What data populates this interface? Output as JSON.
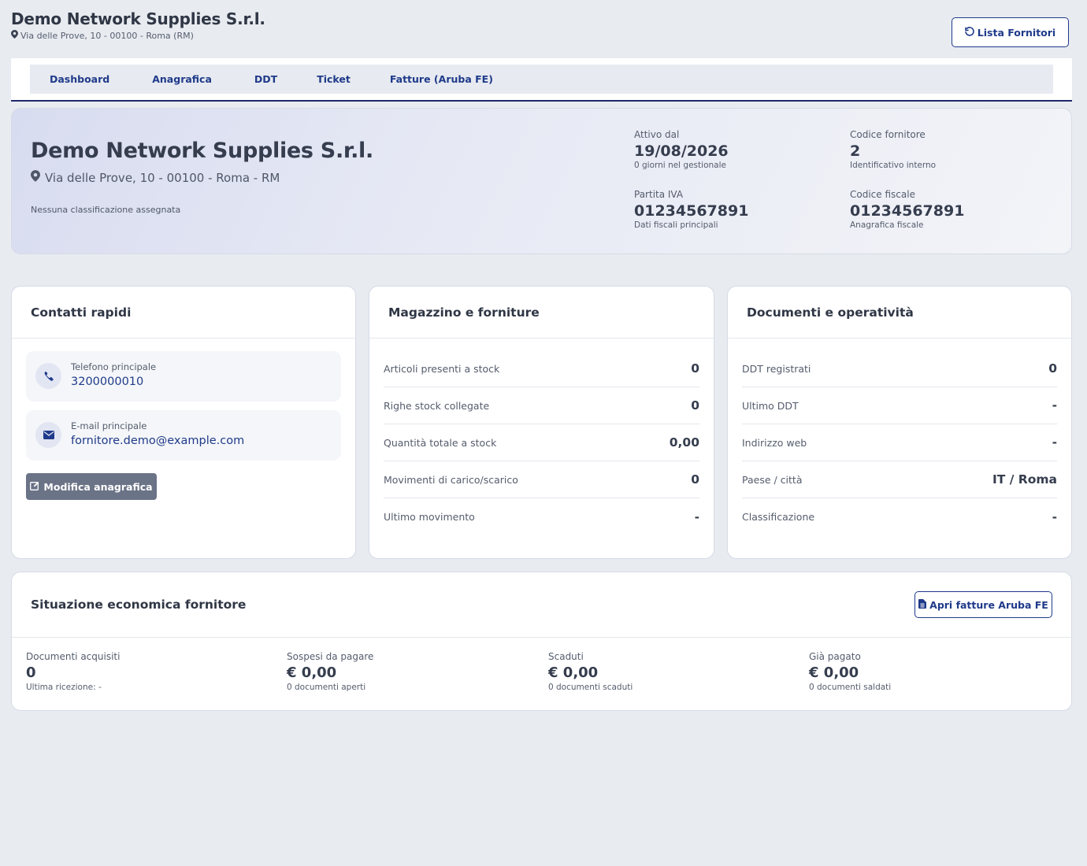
{
  "header": {
    "title": "Demo Network Supplies S.r.l.",
    "address": "Via delle Prove, 10 - 00100 - Roma (RM)",
    "back_button": "Lista Fornitori"
  },
  "tabs": [
    {
      "label": "Dashboard"
    },
    {
      "label": "Anagrafica"
    },
    {
      "label": "DDT"
    },
    {
      "label": "Ticket"
    },
    {
      "label": "Fatture (Aruba FE)"
    }
  ],
  "hero": {
    "name": "Demo Network Supplies S.r.l.",
    "address": "Via delle Prove, 10 - 00100 - Roma - RM",
    "classification": "Nessuna classificazione assegnata",
    "stats": [
      {
        "label": "Attivo dal",
        "value": "19/08/2026",
        "sub": "0 giorni nel gestionale"
      },
      {
        "label": "Codice fornitore",
        "value": "2",
        "sub": "Identificativo interno"
      },
      {
        "label": "Partita IVA",
        "value": "01234567891",
        "sub": "Dati fiscali principali"
      },
      {
        "label": "Codice fiscale",
        "value": "01234567891",
        "sub": "Anagrafica fiscale"
      }
    ]
  },
  "contacts": {
    "title": "Contatti rapidi",
    "phone": {
      "label": "Telefono principale",
      "value": "3200000010"
    },
    "email": {
      "label": "E-mail principale",
      "value": "fornitore.demo@example.com"
    },
    "edit_button": "Modifica anagrafica"
  },
  "warehouse": {
    "title": "Magazzino e forniture",
    "rows": [
      {
        "label": "Articoli presenti a stock",
        "value": "0"
      },
      {
        "label": "Righe stock collegate",
        "value": "0"
      },
      {
        "label": "Quantità totale a stock",
        "value": "0,00"
      },
      {
        "label": "Movimenti di carico/scarico",
        "value": "0"
      },
      {
        "label": "Ultimo movimento",
        "value": "-"
      }
    ]
  },
  "documents": {
    "title": "Documenti e operatività",
    "rows": [
      {
        "label": "DDT registrati",
        "value": "0"
      },
      {
        "label": "Ultimo DDT",
        "value": "-"
      },
      {
        "label": "Indirizzo web",
        "value": "-"
      },
      {
        "label": "Paese / città",
        "value": "IT / Roma"
      },
      {
        "label": "Classificazione",
        "value": "-"
      }
    ]
  },
  "economics": {
    "title": "Situazione economica fornitore",
    "button": "Apri fatture Aruba FE",
    "cells": [
      {
        "label": "Documenti acquisiti",
        "value": "0",
        "sub": "Ultima ricezione: -"
      },
      {
        "label": "Sospesi da pagare",
        "value": "€ 0,00",
        "sub": "0 documenti aperti"
      },
      {
        "label": "Scaduti",
        "value": "€ 0,00",
        "sub": "0 documenti scaduti"
      },
      {
        "label": "Già pagato",
        "value": "€ 0,00",
        "sub": "0 documenti saldati"
      }
    ]
  },
  "colors": {
    "accent": "#1f3a8a",
    "background": "#e8ebf0",
    "button_secondary": "#6b7387"
  },
  "icons": {
    "map_pin": "map-pin-icon",
    "undo": "undo-icon",
    "phone": "phone-icon",
    "envelope": "envelope-icon",
    "edit": "edit-icon",
    "file": "file-icon"
  }
}
